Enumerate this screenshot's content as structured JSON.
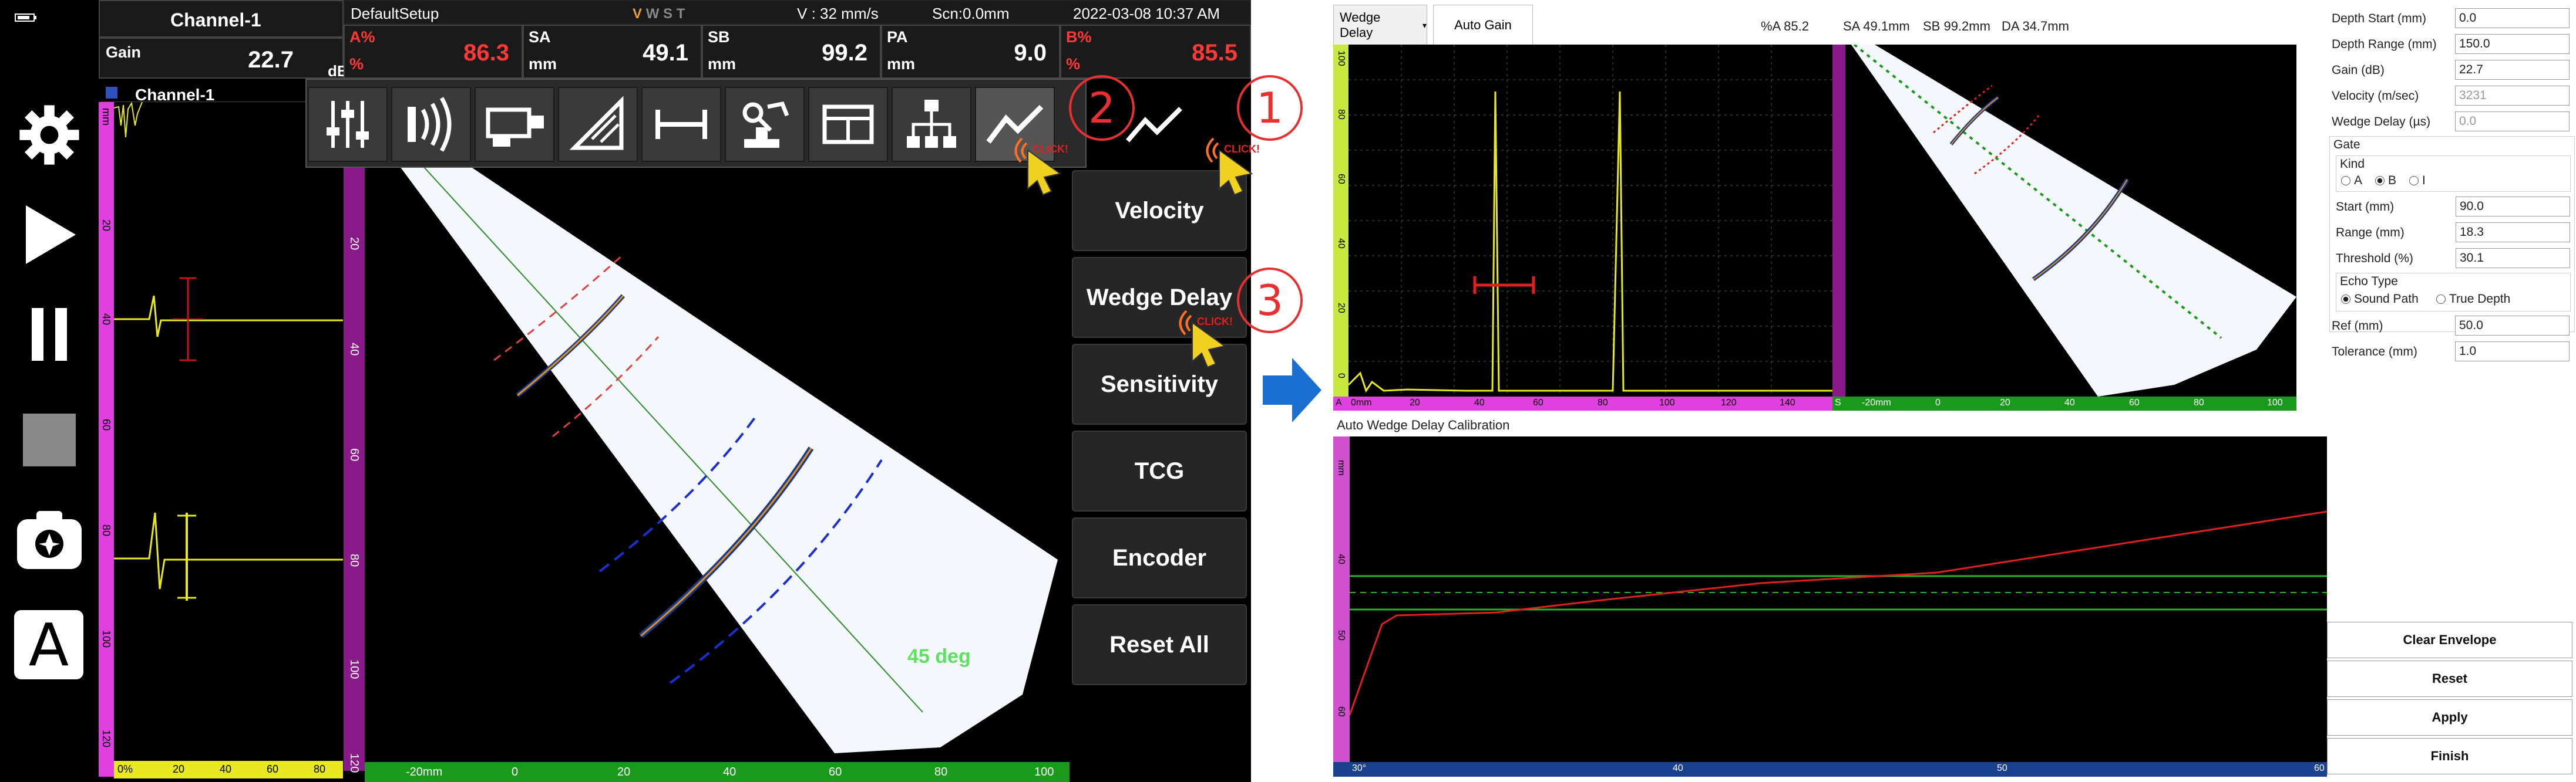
{
  "left": {
    "channel_header": "Channel-1",
    "gain_label": "Gain",
    "gain_value": "22.7",
    "gain_unit": "dB",
    "setup_name": "DefaultSetup",
    "mode_letters": [
      "V",
      "W",
      "S",
      "T"
    ],
    "velocity_status": "V : 32 mm/s",
    "scan_status": "Scn:0.0mm",
    "datetime": "2022-03-08 10:37 AM",
    "readouts": [
      {
        "label": "A%",
        "unit": "%",
        "value": "86.3",
        "red": true
      },
      {
        "label": "SA",
        "unit": "mm",
        "value": "49.1",
        "red": false
      },
      {
        "label": "SB",
        "unit": "mm",
        "value": "99.2",
        "red": false
      },
      {
        "label": "PA",
        "unit": "mm",
        "value": "9.0",
        "red": false
      },
      {
        "label": "B%",
        "unit": "%",
        "value": "85.5",
        "red": true
      }
    ],
    "ascan_title": "Channel-1",
    "ascan_unit": "mm",
    "ascan_ticks": [
      "20",
      "40",
      "60",
      "80",
      "100",
      "120"
    ],
    "ascan_bottom_ticks": [
      "0%",
      "20",
      "40",
      "60",
      "80"
    ],
    "sscan_ticks": [
      "20",
      "40",
      "60",
      "80",
      "100",
      "120"
    ],
    "sscan_bottom_ticks": [
      "-20mm",
      "0",
      "20",
      "40",
      "60",
      "80",
      "100"
    ],
    "angle_label": "45 deg",
    "menu_buttons": [
      "Velocity",
      "Wedge Delay",
      "Sensitivity",
      "TCG",
      "Encoder",
      "Reset All"
    ],
    "click_label": "CLICK!",
    "step_numbers": [
      "1",
      "2",
      "3"
    ],
    "sidebar_letter": "A"
  },
  "right": {
    "dropdown": "Wedge Delay",
    "auto_gain": "Auto Gain",
    "status": [
      "%A 85.2",
      "SA 49.1mm",
      "SB 99.2mm",
      "DA 34.7mm"
    ],
    "ascan_ticks": [
      "0mm",
      "20",
      "40",
      "60",
      "80",
      "100",
      "120",
      "140"
    ],
    "ascan_left_ticks": [
      "100",
      "80",
      "60",
      "40",
      "20",
      "0"
    ],
    "ascan_left_label": "A",
    "ascan_right_label": "S",
    "sscan_ticks": [
      "-20mm",
      "0",
      "20",
      "40",
      "60",
      "80",
      "100"
    ],
    "calib_title": "Auto Wedge Delay Calibration",
    "calib_x_ticks": [
      "30°",
      "40",
      "50",
      "60"
    ],
    "calib_y_ticks": [
      "mm",
      "40",
      "50",
      "60"
    ],
    "params": [
      {
        "label": "Depth Start (mm)",
        "value": "0.0"
      },
      {
        "label": "Depth Range (mm)",
        "value": "150.0"
      },
      {
        "label": "Gain (dB)",
        "value": "22.7"
      },
      {
        "label": "Velocity (m/sec)",
        "value": "3231"
      },
      {
        "label": "Wedge Delay (µs)",
        "value": "0.0"
      }
    ],
    "gate_title": "Gate",
    "kind_title": "Kind",
    "kind_options": [
      "A",
      "B",
      "I"
    ],
    "gate_params": [
      {
        "label": "Start (mm)",
        "value": "90.0"
      },
      {
        "label": "Range (mm)",
        "value": "18.3"
      },
      {
        "label": "Threshold (%)",
        "value": "30.1"
      }
    ],
    "echo_title": "Echo Type",
    "echo_options": [
      "Sound Path",
      "True Depth"
    ],
    "ref_params": [
      {
        "label": "Ref (mm)",
        "value": "50.0"
      },
      {
        "label": "Tolerance (mm)",
        "value": "1.0"
      }
    ],
    "buttons": [
      "Clear Envelope",
      "Reset",
      "Apply",
      "Finish"
    ]
  },
  "colors": {
    "accent_red": "#ff3838",
    "ruler_magenta": "#e040e0",
    "ruler_green": "#1a9a1a",
    "signal_yellow": "#e8e820"
  }
}
